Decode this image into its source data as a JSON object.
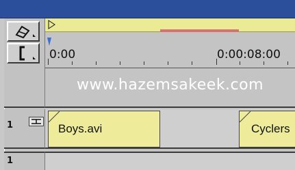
{
  "ruler": {
    "start_time": "0:00",
    "end_time": "0:00:08:00"
  },
  "watermark": "www.hazemsakeek.com",
  "tracks": [
    {
      "number": "1",
      "clips": [
        {
          "label": "Boys.avi"
        },
        {
          "label": "Cyclers"
        }
      ]
    },
    {
      "number": "1"
    }
  ],
  "tools": [
    "hand-tool-icon",
    "in-point-bracket-icon"
  ],
  "colors": {
    "title_bar": "#2c4f9c",
    "work_area": "#eaeb94",
    "work_area_bar": "#d77272",
    "clip_fill": "#eeec9a",
    "watermark_text": "#ffffff"
  }
}
